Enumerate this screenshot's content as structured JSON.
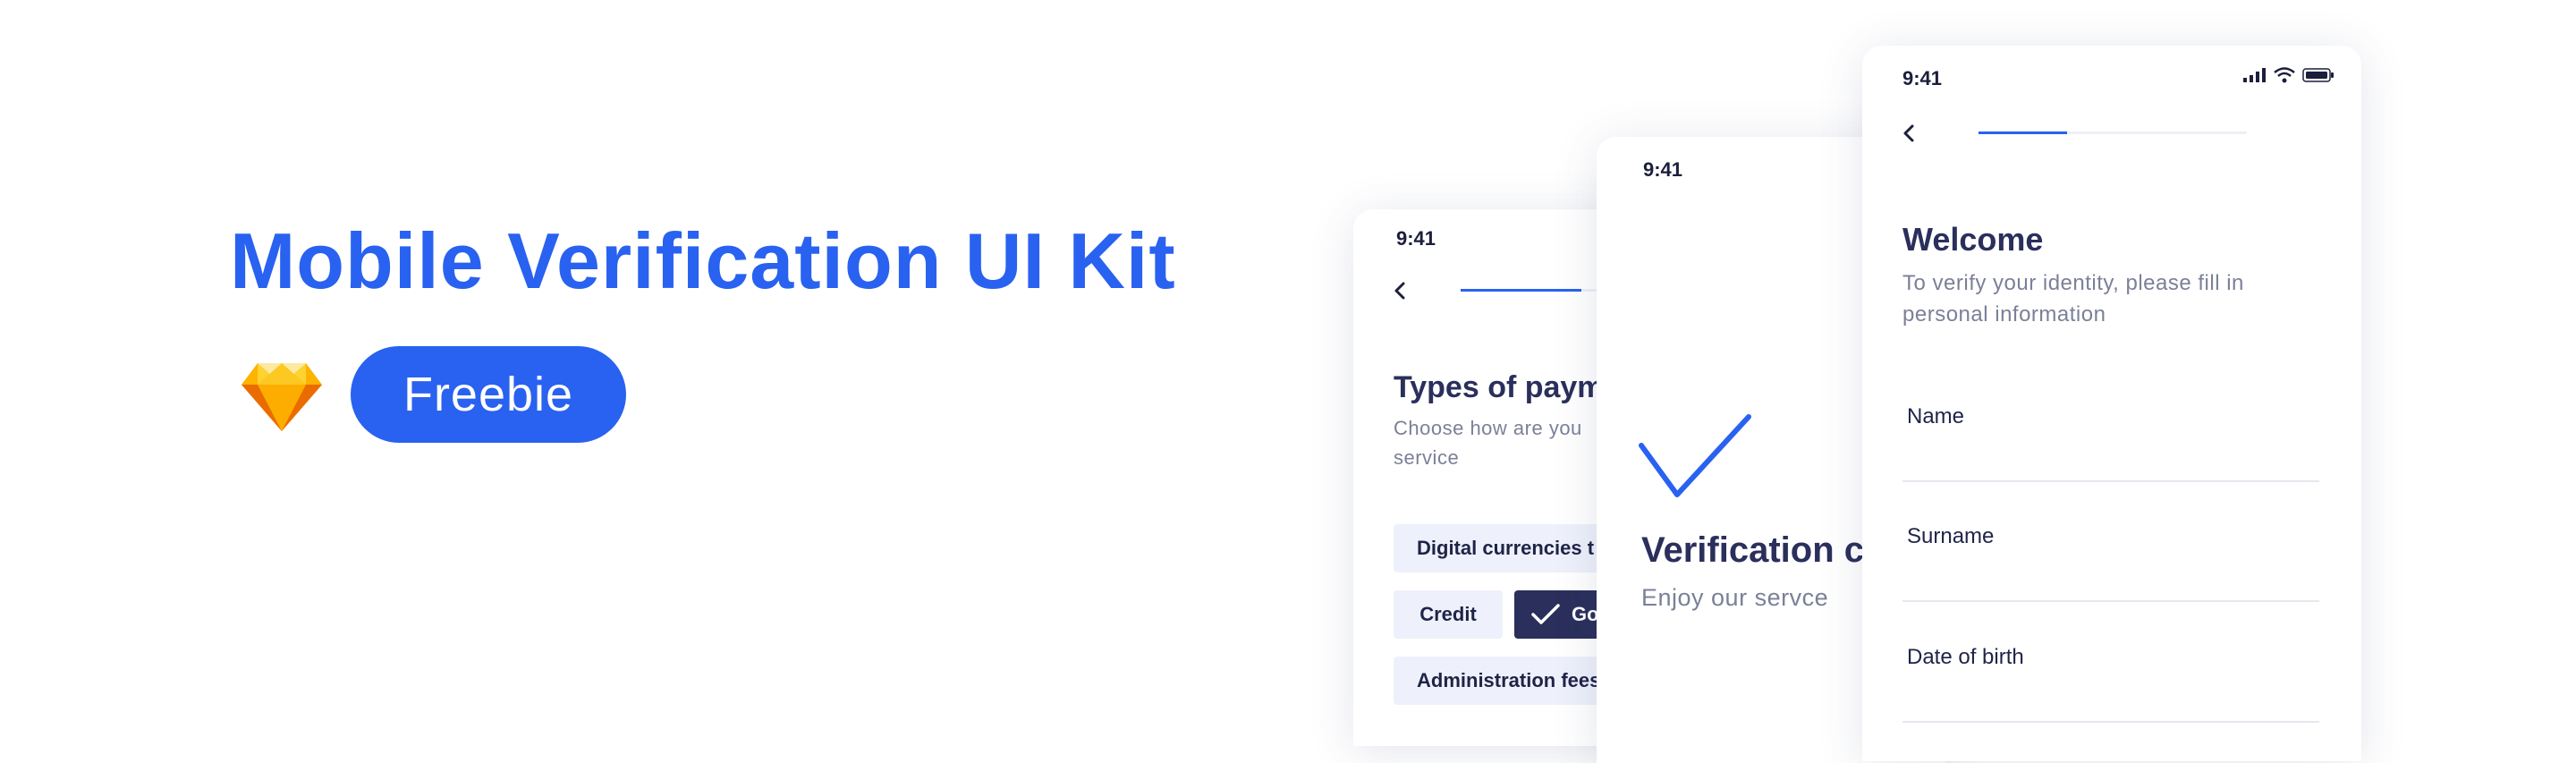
{
  "hero": {
    "title": "Mobile Verification UI Kit",
    "badge_label": "Freebie",
    "logo_icon": "sketch-diamond-icon",
    "accent_color": "#2962f0"
  },
  "screens": {
    "payment": {
      "time": "9:41",
      "title": "Types of paym",
      "subtitle_line1": "Choose how are you",
      "subtitle_line2": "service",
      "chips": [
        {
          "label": "Digital currencies t",
          "selected": false
        },
        {
          "label": "Credit",
          "selected": false
        },
        {
          "label": "Goo",
          "selected": true
        },
        {
          "label": "Administration fees",
          "selected": false
        }
      ],
      "progress": 0.45
    },
    "complete": {
      "time": "9:41",
      "title": "Verification c",
      "subtitle": "Enjoy our servce"
    },
    "welcome": {
      "time": "9:41",
      "title": "Welcome",
      "subtitle_line1": "To verify your identity, please fill in",
      "subtitle_line2": "personal information",
      "progress": 0.33,
      "fields": [
        "Name",
        "Surname",
        "Date of birth"
      ]
    }
  },
  "colors": {
    "primary": "#2962f0",
    "dark": "#2a2f5c",
    "chip_bg": "#eef1fb",
    "muted": "#7b8098"
  }
}
